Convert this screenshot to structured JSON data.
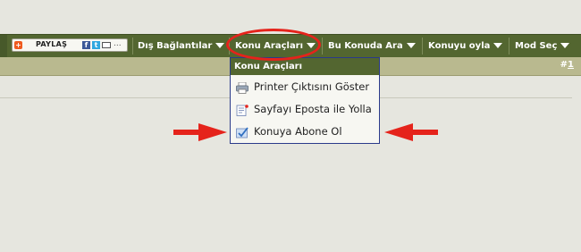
{
  "share": {
    "label": "PAYLAŞ",
    "plus": "+",
    "fb": "f",
    "tw": "t",
    "more": "..."
  },
  "nav": [
    {
      "label": "Dış Bağlantılar"
    },
    {
      "label": "Konu Araçları"
    },
    {
      "label": "Bu Konuda Ara"
    },
    {
      "label": "Konuyu oyla"
    },
    {
      "label": "Mod Seç"
    }
  ],
  "post": {
    "prefix": "#",
    "number": "1"
  },
  "dropdown": {
    "title": "Konu Araçları",
    "items": [
      {
        "label": "Printer Çıktısını Göster",
        "icon": "printer-icon"
      },
      {
        "label": "Sayfayı Eposta ile Yolla",
        "icon": "email-page-icon"
      },
      {
        "label": "Konuya Abone Ol",
        "icon": "subscribe-icon"
      }
    ]
  },
  "colors": {
    "bar": "#536630",
    "subbar": "#b9b98f",
    "highlight": "#e5231b",
    "background": "#e6e6df"
  }
}
